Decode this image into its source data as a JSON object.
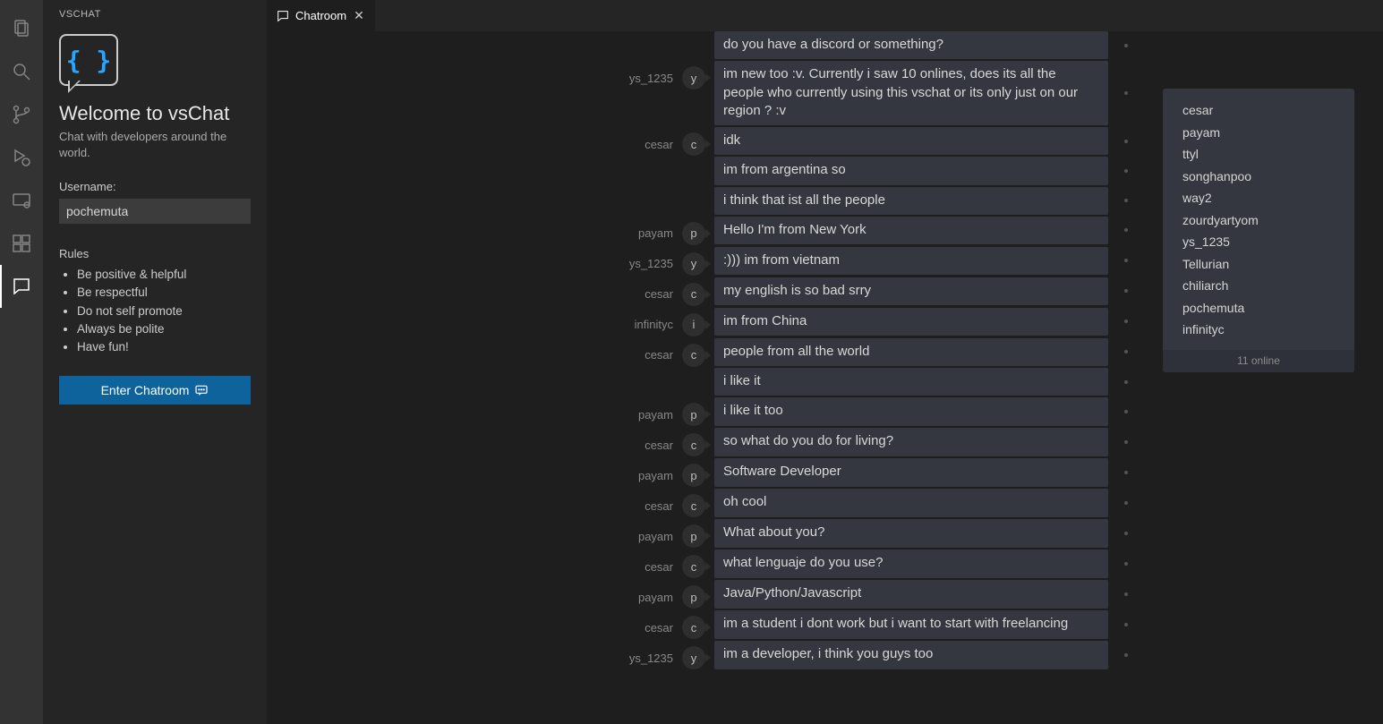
{
  "sidebar": {
    "section_title": "VSCHAT",
    "logo_text": "{ }",
    "welcome_heading": "Welcome to vsChat",
    "welcome_sub": "Chat with developers around the world.",
    "username_label": "Username:",
    "username_value": "pochemuta",
    "rules_heading": "Rules",
    "rules": [
      "Be positive & helpful",
      "Be respectful",
      "Do not self promote",
      "Always be polite",
      "Have fun!"
    ],
    "enter_label": "Enter Chatroom"
  },
  "tab": {
    "label": "Chatroom"
  },
  "messages": [
    {
      "user": "",
      "avatar": "",
      "lines": [
        "do you have a discord or something?"
      ]
    },
    {
      "user": "ys_1235",
      "avatar": "y",
      "lines": [
        "im new too :v. Currently i saw 10 onlines, does its all the people who currently using this vschat or its only just on our region ? :v"
      ]
    },
    {
      "user": "cesar",
      "avatar": "c",
      "lines": [
        "idk",
        "im from argentina so",
        "i think that ist all the people"
      ]
    },
    {
      "user": "payam",
      "avatar": "p",
      "lines": [
        "Hello I'm from New York"
      ]
    },
    {
      "user": "ys_1235",
      "avatar": "y",
      "lines": [
        ":))) im from vietnam"
      ]
    },
    {
      "user": "cesar",
      "avatar": "c",
      "lines": [
        "my english is so bad srry"
      ]
    },
    {
      "user": "infinityc",
      "avatar": "i",
      "lines": [
        "im from China"
      ]
    },
    {
      "user": "cesar",
      "avatar": "c",
      "lines": [
        "people from all the world",
        "i like it"
      ]
    },
    {
      "user": "payam",
      "avatar": "p",
      "lines": [
        "i like it too"
      ]
    },
    {
      "user": "cesar",
      "avatar": "c",
      "lines": [
        "so what do you do for living?"
      ]
    },
    {
      "user": "payam",
      "avatar": "p",
      "lines": [
        "Software Developer"
      ]
    },
    {
      "user": "cesar",
      "avatar": "c",
      "lines": [
        "oh cool"
      ]
    },
    {
      "user": "payam",
      "avatar": "p",
      "lines": [
        "What about you?"
      ]
    },
    {
      "user": "cesar",
      "avatar": "c",
      "lines": [
        "what lenguaje do you use?"
      ]
    },
    {
      "user": "payam",
      "avatar": "p",
      "lines": [
        "Java/Python/Javascript"
      ]
    },
    {
      "user": "cesar",
      "avatar": "c",
      "lines": [
        "im a student i dont work but i want to start with freelancing"
      ]
    },
    {
      "user": "ys_1235",
      "avatar": "y",
      "lines": [
        "im a developer, i think you guys too"
      ]
    }
  ],
  "online": {
    "users": [
      "cesar",
      "payam",
      "ttyl",
      "songhanpoo",
      "way2",
      "zourdyartyom",
      "ys_1235",
      "Tellurian",
      "chiliarch",
      "pochemuta",
      "infinityc"
    ],
    "footer": "11 online"
  }
}
